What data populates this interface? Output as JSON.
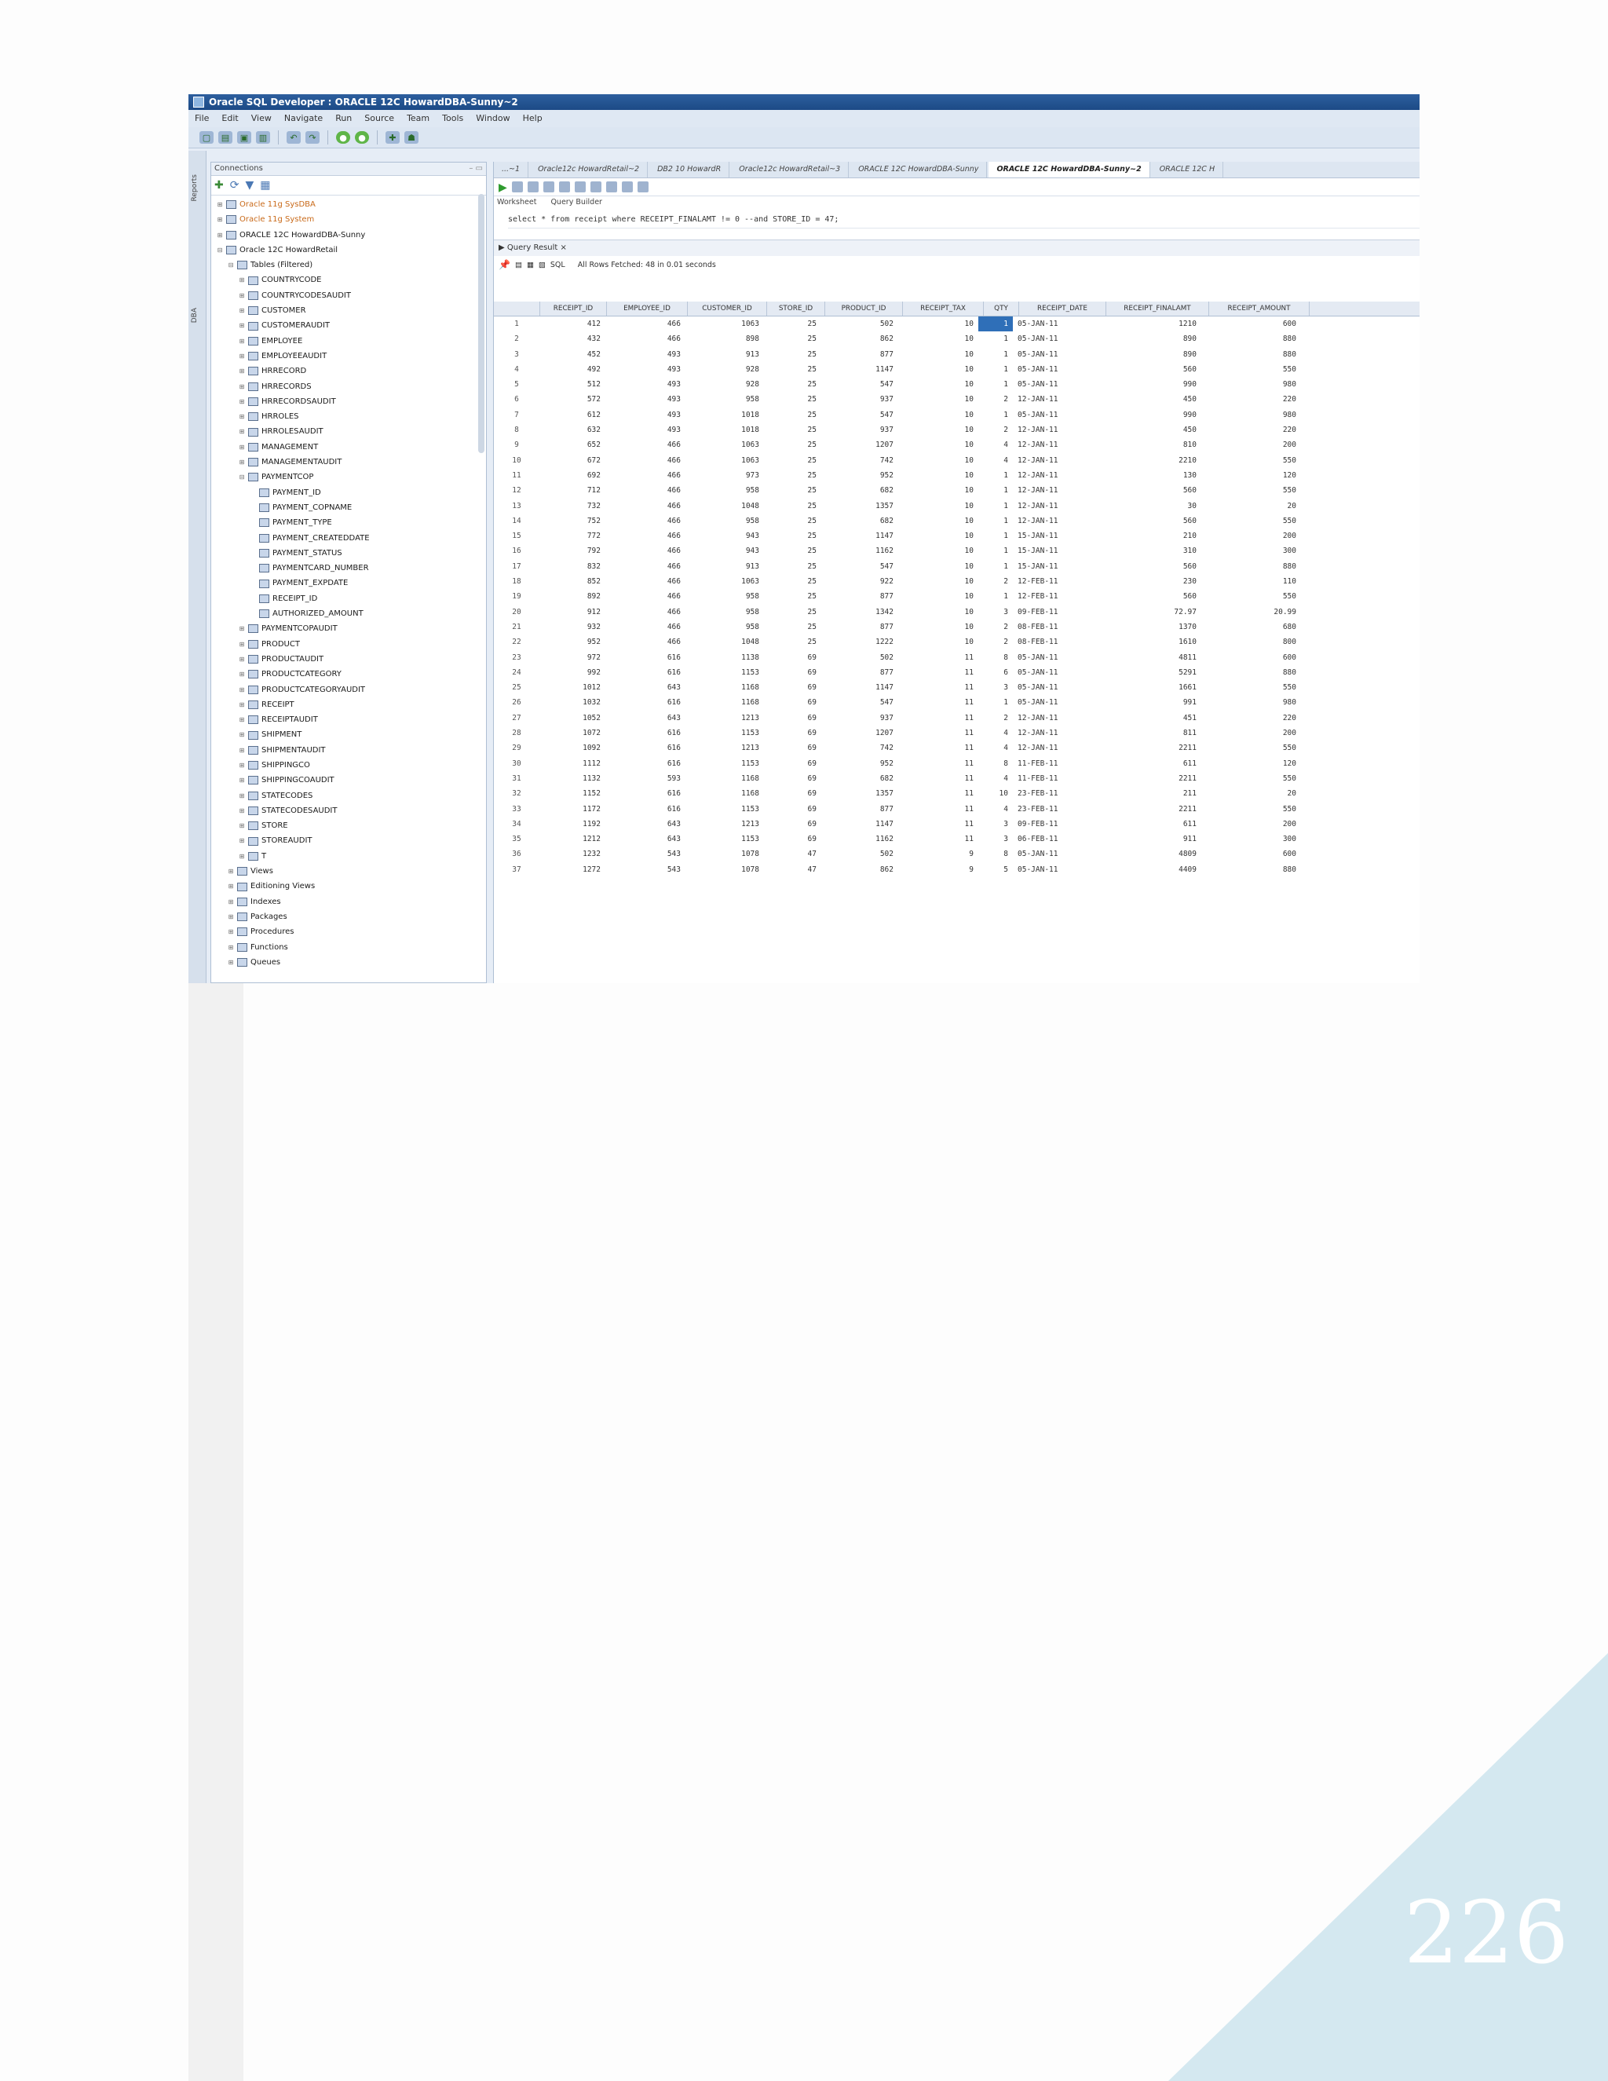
{
  "window": {
    "title": "Oracle SQL Developer : ORACLE 12C HowardDBA-Sunny~2"
  },
  "menu": [
    "File",
    "Edit",
    "View",
    "Navigate",
    "Run",
    "Source",
    "Team",
    "Tools",
    "Window",
    "Help"
  ],
  "side_tabs": [
    "Reports",
    "DBA"
  ],
  "connections_panel": {
    "title": "Connections",
    "tree": [
      {
        "label": "Oracle 11g SysDBA",
        "level": 0,
        "style": "orange"
      },
      {
        "label": "Oracle 11g System",
        "level": 0,
        "style": "orange"
      },
      {
        "label": "ORACLE 12C HowardDBA-Sunny",
        "level": 0
      },
      {
        "label": "Oracle 12C HowardRetail",
        "level": 0,
        "expanded": true
      },
      {
        "label": "Tables (Filtered)",
        "level": 1,
        "expanded": true
      },
      {
        "label": "COUNTRYCODE",
        "level": 2
      },
      {
        "label": "COUNTRYCODESAUDIT",
        "level": 2
      },
      {
        "label": "CUSTOMER",
        "level": 2
      },
      {
        "label": "CUSTOMERAUDIT",
        "level": 2
      },
      {
        "label": "EMPLOYEE",
        "level": 2
      },
      {
        "label": "EMPLOYEEAUDIT",
        "level": 2
      },
      {
        "label": "HRRECORD",
        "level": 2
      },
      {
        "label": "HRRECORDS",
        "level": 2
      },
      {
        "label": "HRRECORDSAUDIT",
        "level": 2
      },
      {
        "label": "HRROLES",
        "level": 2
      },
      {
        "label": "HRROLESAUDIT",
        "level": 2
      },
      {
        "label": "MANAGEMENT",
        "level": 2
      },
      {
        "label": "MANAGEMENTAUDIT",
        "level": 2
      },
      {
        "label": "PAYMENTCOP",
        "level": 2,
        "expanded": true
      },
      {
        "label": "PAYMENT_ID",
        "level": 3
      },
      {
        "label": "PAYMENT_COPNAME",
        "level": 3
      },
      {
        "label": "PAYMENT_TYPE",
        "level": 3
      },
      {
        "label": "PAYMENT_CREATEDDATE",
        "level": 3
      },
      {
        "label": "PAYMENT_STATUS",
        "level": 3
      },
      {
        "label": "PAYMENTCARD_NUMBER",
        "level": 3
      },
      {
        "label": "PAYMENT_EXPDATE",
        "level": 3
      },
      {
        "label": "RECEIPT_ID",
        "level": 3
      },
      {
        "label": "AUTHORIZED_AMOUNT",
        "level": 3
      },
      {
        "label": "PAYMENTCOPAUDIT",
        "level": 2
      },
      {
        "label": "PRODUCT",
        "level": 2
      },
      {
        "label": "PRODUCTAUDIT",
        "level": 2
      },
      {
        "label": "PRODUCTCATEGORY",
        "level": 2
      },
      {
        "label": "PRODUCTCATEGORYAUDIT",
        "level": 2
      },
      {
        "label": "RECEIPT",
        "level": 2
      },
      {
        "label": "RECEIPTAUDIT",
        "level": 2
      },
      {
        "label": "SHIPMENT",
        "level": 2
      },
      {
        "label": "SHIPMENTAUDIT",
        "level": 2
      },
      {
        "label": "SHIPPINGCO",
        "level": 2
      },
      {
        "label": "SHIPPINGCOAUDIT",
        "level": 2
      },
      {
        "label": "STATECODES",
        "level": 2
      },
      {
        "label": "STATECODESAUDIT",
        "level": 2
      },
      {
        "label": "STORE",
        "level": 2
      },
      {
        "label": "STOREAUDIT",
        "level": 2
      },
      {
        "label": "T",
        "level": 2
      },
      {
        "label": "Views",
        "level": 1
      },
      {
        "label": "Editioning Views",
        "level": 1
      },
      {
        "label": "Indexes",
        "level": 1
      },
      {
        "label": "Packages",
        "level": 1
      },
      {
        "label": "Procedures",
        "level": 1
      },
      {
        "label": "Functions",
        "level": 1
      },
      {
        "label": "Queues",
        "level": 1
      }
    ]
  },
  "editor": {
    "tabs": [
      "...~1",
      "Oracle12c HowardRetail~2",
      "DB2 10 HowardR",
      "Oracle12c HowardRetail~3",
      "ORACLE 12C HowardDBA-Sunny",
      "ORACLE 12C HowardDBA-Sunny~2",
      "ORACLE 12C H"
    ],
    "active_tab": 5,
    "subtabs": [
      "Worksheet",
      "Query Builder"
    ],
    "sql": "select * from receipt where RECEIPT_FINALAMT != 0 --and STORE_ID = 47;",
    "result_tab": "Query Result",
    "result_status": "All Rows Fetched: 48 in 0.01 seconds",
    "sql_label": "SQL"
  },
  "result": {
    "columns": [
      "",
      "RECEIPT_ID",
      "EMPLOYEE_ID",
      "CUSTOMER_ID",
      "STORE_ID",
      "PRODUCT_ID",
      "RECEIPT_TAX",
      "QTY",
      "RECEIPT_DATE",
      "RECEIPT_FINALAMT",
      "RECEIPT_AMOUNT"
    ],
    "rows": [
      [
        "1",
        "412",
        "466",
        "1063",
        "25",
        "502",
        "10",
        "1",
        "05-JAN-11",
        "1210",
        "600"
      ],
      [
        "2",
        "432",
        "466",
        "898",
        "25",
        "862",
        "10",
        "1",
        "05-JAN-11",
        "890",
        "880"
      ],
      [
        "3",
        "452",
        "493",
        "913",
        "25",
        "877",
        "10",
        "1",
        "05-JAN-11",
        "890",
        "880"
      ],
      [
        "4",
        "492",
        "493",
        "928",
        "25",
        "1147",
        "10",
        "1",
        "05-JAN-11",
        "560",
        "550"
      ],
      [
        "5",
        "512",
        "493",
        "928",
        "25",
        "547",
        "10",
        "1",
        "05-JAN-11",
        "990",
        "980"
      ],
      [
        "6",
        "572",
        "493",
        "958",
        "25",
        "937",
        "10",
        "2",
        "12-JAN-11",
        "450",
        "220"
      ],
      [
        "7",
        "612",
        "493",
        "1018",
        "25",
        "547",
        "10",
        "1",
        "05-JAN-11",
        "990",
        "980"
      ],
      [
        "8",
        "632",
        "493",
        "1018",
        "25",
        "937",
        "10",
        "2",
        "12-JAN-11",
        "450",
        "220"
      ],
      [
        "9",
        "652",
        "466",
        "1063",
        "25",
        "1207",
        "10",
        "4",
        "12-JAN-11",
        "810",
        "200"
      ],
      [
        "10",
        "672",
        "466",
        "1063",
        "25",
        "742",
        "10",
        "4",
        "12-JAN-11",
        "2210",
        "550"
      ],
      [
        "11",
        "692",
        "466",
        "973",
        "25",
        "952",
        "10",
        "1",
        "12-JAN-11",
        "130",
        "120"
      ],
      [
        "12",
        "712",
        "466",
        "958",
        "25",
        "682",
        "10",
        "1",
        "12-JAN-11",
        "560",
        "550"
      ],
      [
        "13",
        "732",
        "466",
        "1048",
        "25",
        "1357",
        "10",
        "1",
        "12-JAN-11",
        "30",
        "20"
      ],
      [
        "14",
        "752",
        "466",
        "958",
        "25",
        "682",
        "10",
        "1",
        "12-JAN-11",
        "560",
        "550"
      ],
      [
        "15",
        "772",
        "466",
        "943",
        "25",
        "1147",
        "10",
        "1",
        "15-JAN-11",
        "210",
        "200"
      ],
      [
        "16",
        "792",
        "466",
        "943",
        "25",
        "1162",
        "10",
        "1",
        "15-JAN-11",
        "310",
        "300"
      ],
      [
        "17",
        "832",
        "466",
        "913",
        "25",
        "547",
        "10",
        "1",
        "15-JAN-11",
        "560",
        "880"
      ],
      [
        "18",
        "852",
        "466",
        "1063",
        "25",
        "922",
        "10",
        "2",
        "12-FEB-11",
        "230",
        "110"
      ],
      [
        "19",
        "892",
        "466",
        "958",
        "25",
        "877",
        "10",
        "1",
        "12-FEB-11",
        "560",
        "550"
      ],
      [
        "20",
        "912",
        "466",
        "958",
        "25",
        "1342",
        "10",
        "3",
        "09-FEB-11",
        "72.97",
        "20.99"
      ],
      [
        "21",
        "932",
        "466",
        "958",
        "25",
        "877",
        "10",
        "2",
        "08-FEB-11",
        "1370",
        "680"
      ],
      [
        "22",
        "952",
        "466",
        "1048",
        "25",
        "1222",
        "10",
        "2",
        "08-FEB-11",
        "1610",
        "800"
      ],
      [
        "23",
        "972",
        "616",
        "1138",
        "69",
        "502",
        "11",
        "8",
        "05-JAN-11",
        "4811",
        "600"
      ],
      [
        "24",
        "992",
        "616",
        "1153",
        "69",
        "877",
        "11",
        "6",
        "05-JAN-11",
        "5291",
        "880"
      ],
      [
        "25",
        "1012",
        "643",
        "1168",
        "69",
        "1147",
        "11",
        "3",
        "05-JAN-11",
        "1661",
        "550"
      ],
      [
        "26",
        "1032",
        "616",
        "1168",
        "69",
        "547",
        "11",
        "1",
        "05-JAN-11",
        "991",
        "980"
      ],
      [
        "27",
        "1052",
        "643",
        "1213",
        "69",
        "937",
        "11",
        "2",
        "12-JAN-11",
        "451",
        "220"
      ],
      [
        "28",
        "1072",
        "616",
        "1153",
        "69",
        "1207",
        "11",
        "4",
        "12-JAN-11",
        "811",
        "200"
      ],
      [
        "29",
        "1092",
        "616",
        "1213",
        "69",
        "742",
        "11",
        "4",
        "12-JAN-11",
        "2211",
        "550"
      ],
      [
        "30",
        "1112",
        "616",
        "1153",
        "69",
        "952",
        "11",
        "8",
        "11-FEB-11",
        "611",
        "120"
      ],
      [
        "31",
        "1132",
        "593",
        "1168",
        "69",
        "682",
        "11",
        "4",
        "11-FEB-11",
        "2211",
        "550"
      ],
      [
        "32",
        "1152",
        "616",
        "1168",
        "69",
        "1357",
        "11",
        "10",
        "23-FEB-11",
        "211",
        "20"
      ],
      [
        "33",
        "1172",
        "616",
        "1153",
        "69",
        "877",
        "11",
        "4",
        "23-FEB-11",
        "2211",
        "550"
      ],
      [
        "34",
        "1192",
        "643",
        "1213",
        "69",
        "1147",
        "11",
        "3",
        "09-FEB-11",
        "611",
        "200"
      ],
      [
        "35",
        "1212",
        "643",
        "1153",
        "69",
        "1162",
        "11",
        "3",
        "06-FEB-11",
        "911",
        "300"
      ],
      [
        "36",
        "1232",
        "543",
        "1078",
        "47",
        "502",
        "9",
        "8",
        "05-JAN-11",
        "4809",
        "600"
      ],
      [
        "37",
        "1272",
        "543",
        "1078",
        "47",
        "862",
        "9",
        "5",
        "05-JAN-11",
        "4409",
        "880"
      ]
    ]
  },
  "page_number": "226",
  "colors": {
    "corner": "#d4e8f0",
    "titlebar": "#2d5f9e"
  }
}
